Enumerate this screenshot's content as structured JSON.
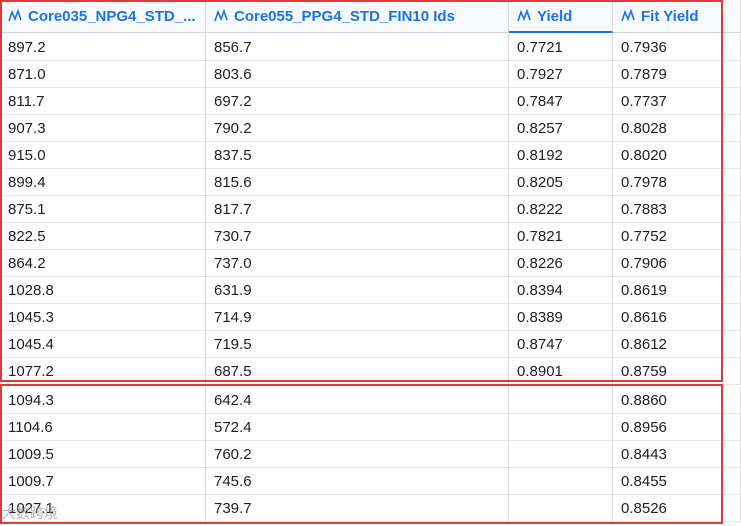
{
  "columns": [
    {
      "label": "Core035_NPG4_STD_...",
      "icon": "number-column-icon"
    },
    {
      "label": "Core055_PPG4_STD_FIN10 Ids",
      "icon": "number-column-icon"
    },
    {
      "label": "Yield",
      "icon": "number-column-icon"
    },
    {
      "label": "Fit Yield",
      "icon": "number-column-icon"
    }
  ],
  "rows": [
    [
      "897.2",
      "856.7",
      "0.7721",
      "0.7936"
    ],
    [
      "871.0",
      "803.6",
      "0.7927",
      "0.7879"
    ],
    [
      "811.7",
      "697.2",
      "0.7847",
      "0.7737"
    ],
    [
      "907.3",
      "790.2",
      "0.8257",
      "0.8028"
    ],
    [
      "915.0",
      "837.5",
      "0.8192",
      "0.8020"
    ],
    [
      "899.4",
      "815.6",
      "0.8205",
      "0.7978"
    ],
    [
      "875.1",
      "817.7",
      "0.8222",
      "0.7883"
    ],
    [
      "822.5",
      "730.7",
      "0.7821",
      "0.7752"
    ],
    [
      "864.2",
      "737.0",
      "0.8226",
      "0.7906"
    ],
    [
      "1028.8",
      "631.9",
      "0.8394",
      "0.8619"
    ],
    [
      "1045.3",
      "714.9",
      "0.8389",
      "0.8616"
    ],
    [
      "1045.4",
      "719.5",
      "0.8747",
      "0.8612"
    ],
    [
      "1077.2",
      "687.5",
      "0.8901",
      "0.8759"
    ],
    [
      "1094.3",
      "642.4",
      "",
      "0.8860"
    ],
    [
      "1104.6",
      "572.4",
      "",
      "0.8956"
    ],
    [
      "1009.5",
      "760.2",
      "",
      "0.8443"
    ],
    [
      "1009.7",
      "745.6",
      "",
      "0.8455"
    ],
    [
      "1027.1",
      "739.7",
      "",
      "0.8526"
    ]
  ],
  "colors": {
    "header_text": "#1a73e8",
    "highlight_border": "#e53935"
  },
  "watermark": "大数跨境"
}
